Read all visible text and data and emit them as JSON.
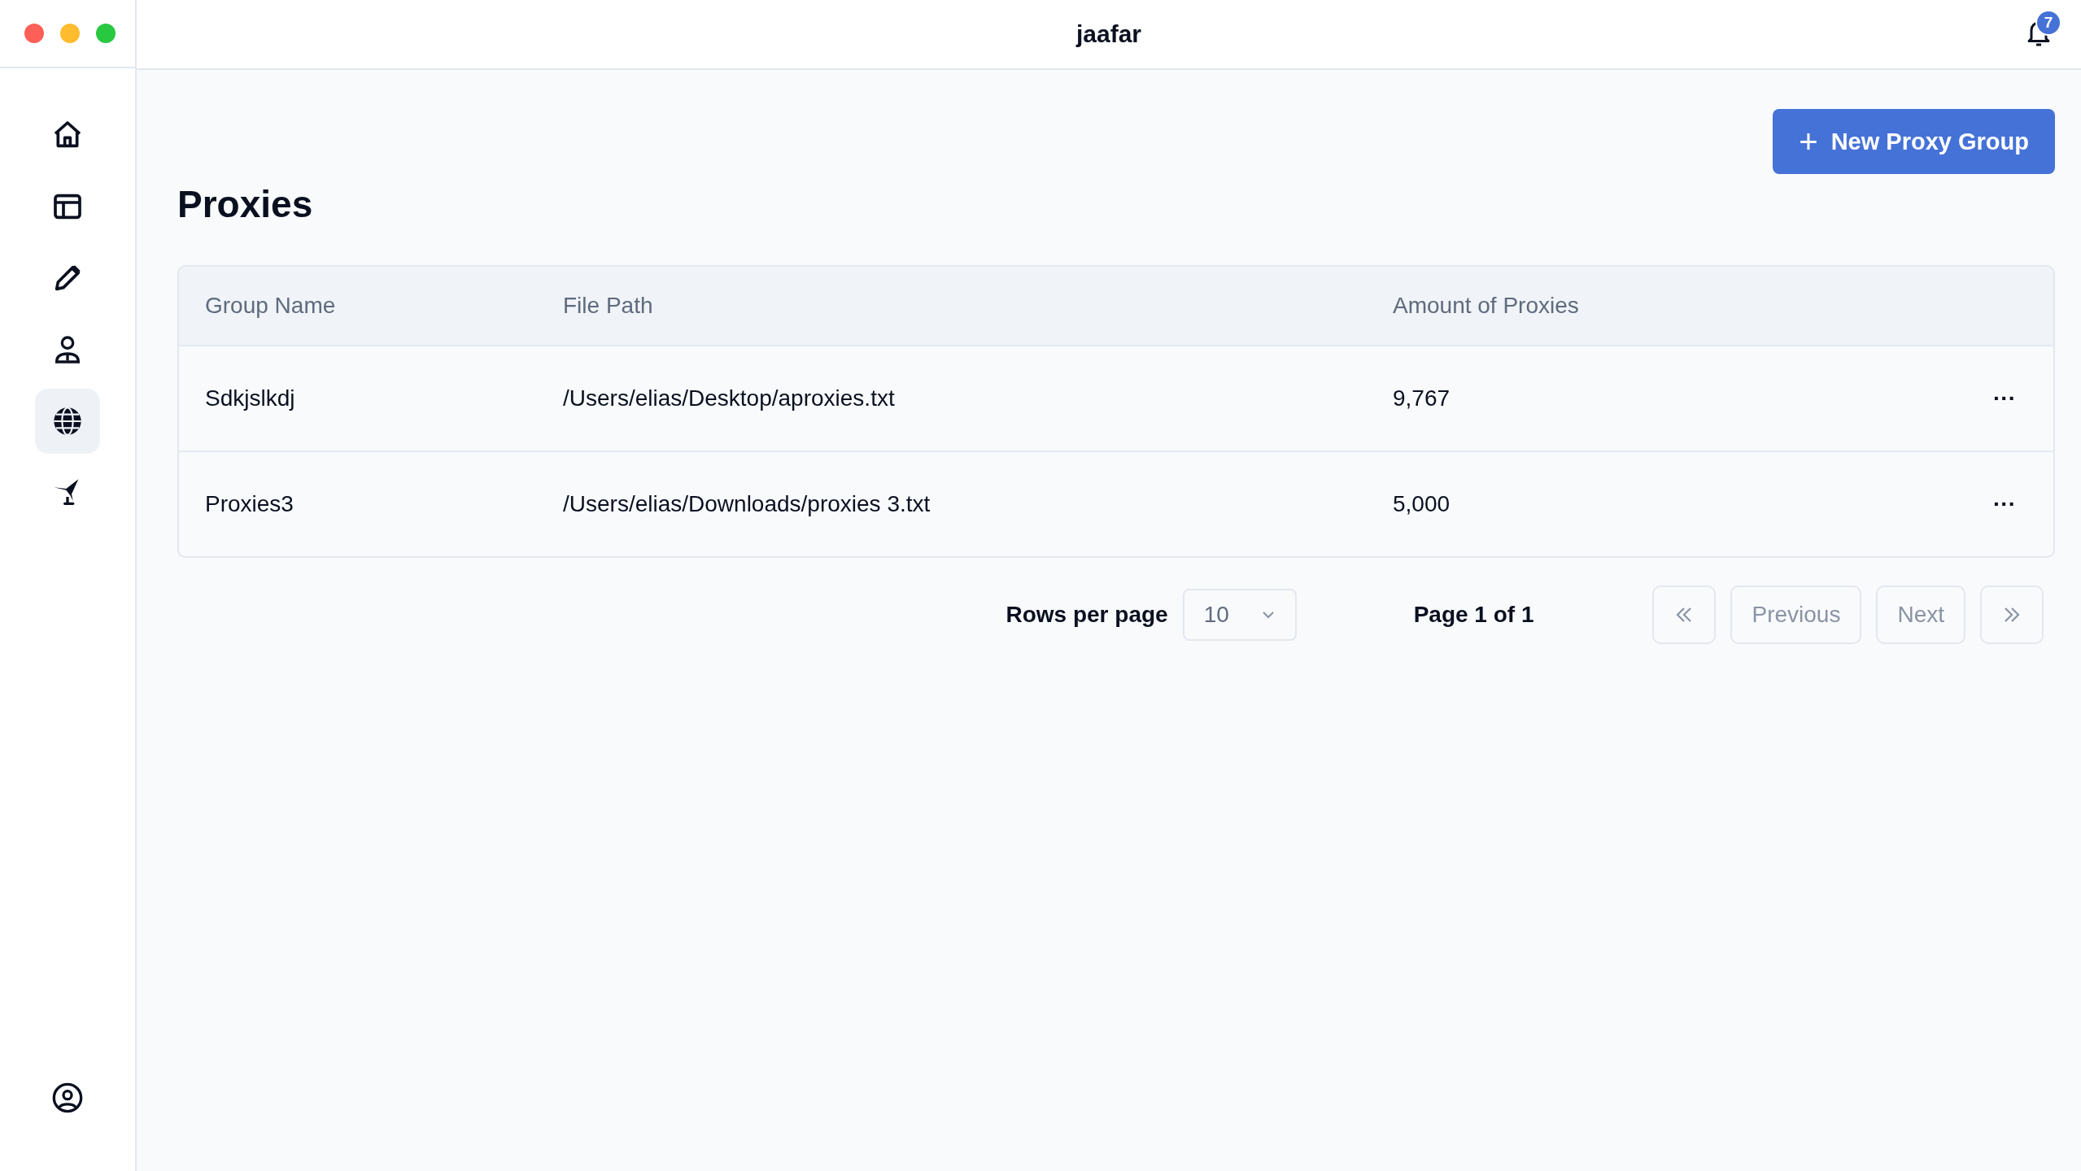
{
  "window": {
    "title": "jaafar"
  },
  "notifications": {
    "count": "7"
  },
  "sidebar": {
    "items": [
      {
        "kind": "home",
        "selected": false
      },
      {
        "kind": "layout",
        "selected": false
      },
      {
        "kind": "pencil",
        "selected": false
      },
      {
        "kind": "person",
        "selected": false
      },
      {
        "kind": "globe",
        "selected": true
      },
      {
        "kind": "plane",
        "selected": false
      }
    ],
    "footer": {
      "kind": "account"
    }
  },
  "page": {
    "title": "Proxies",
    "new_button": {
      "icon": "+",
      "label": "New Proxy Group"
    }
  },
  "table": {
    "columns": [
      "Group Name",
      "File Path",
      "Amount of Proxies"
    ],
    "rows": [
      {
        "cells": [
          "Sdkjslkdj",
          "/Users/elias/Desktop/aproxies.txt",
          "9,767"
        ],
        "menu": "···"
      },
      {
        "cells": [
          "Proxies3",
          "/Users/elias/Downloads/proxies 3.txt",
          "5,000"
        ],
        "menu": "···"
      }
    ]
  },
  "pagination": {
    "rows_label": "Rows per page",
    "rows_value": "10",
    "page_label": "Page 1 of 1",
    "buttons": [
      {
        "kind": "first",
        "disabled": true
      },
      {
        "kind": "text",
        "label": "Previous",
        "disabled": true
      },
      {
        "kind": "text",
        "label": "Next",
        "disabled": true
      },
      {
        "kind": "last",
        "disabled": true
      }
    ]
  }
}
